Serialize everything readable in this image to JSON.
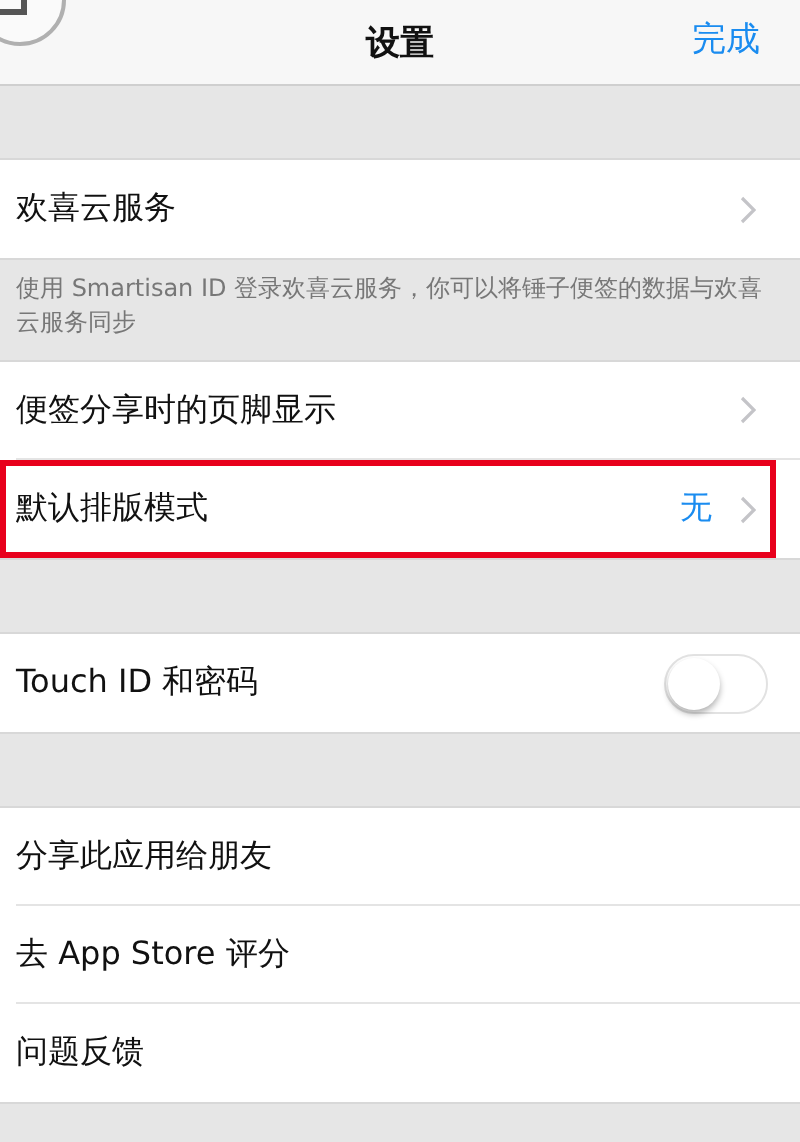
{
  "nav": {
    "title": "设置",
    "done": "完成"
  },
  "sections": [
    {
      "rows": [
        {
          "kind": "link",
          "label": "欢喜云服务",
          "highlighted": false
        }
      ],
      "footer": "使用 Smartisan ID 登录欢喜云服务，你可以将锤子便签的数据与欢喜云服务同步"
    },
    {
      "rows": [
        {
          "kind": "link",
          "label": "便签分享时的页脚显示",
          "highlighted": false
        },
        {
          "kind": "link",
          "label": "默认排版模式",
          "value": "无",
          "highlighted": true
        }
      ]
    },
    {
      "rows": [
        {
          "kind": "toggle",
          "label": "Touch ID 和密码",
          "on": false,
          "highlighted": false
        }
      ]
    },
    {
      "rows": [
        {
          "kind": "plain",
          "label": "分享此应用给朋友",
          "highlighted": false
        },
        {
          "kind": "plain",
          "label": "去 App Store 评分",
          "highlighted": false
        },
        {
          "kind": "plain",
          "label": "问题反馈",
          "highlighted": false
        }
      ]
    }
  ]
}
